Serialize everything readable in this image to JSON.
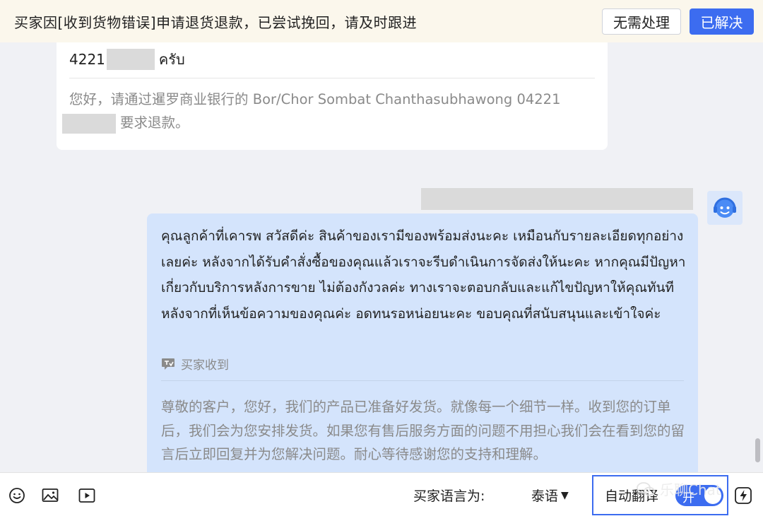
{
  "banner": {
    "message": "买家因[收到货物错误]申请退货退款，已尝试挽回，请及时跟进",
    "no_action_label": "无需处理",
    "resolved_label": "已解决"
  },
  "messages": {
    "incoming": {
      "text_prefix": "4221",
      "text_suffix": "ครับ",
      "translation_prefix": "您好，请通过暹罗商业银行的 Bor/Chor Sombat Chanthasubhawong 04221",
      "translation_suffix": "要求退款。"
    },
    "outgoing": {
      "text": "คุณลูกค้าที่เคารพ สวัสดีค่ะ สินค้าของเรามีของพร้อมส่งนะคะ เหมือนกับรายละเอียดทุกอย่างเลยค่ะ หลังจากได้รับคำสั่งซื้อของคุณแล้วเราจะรีบดำเนินการจัดส่งให้นะคะ หากคุณมีปัญหาเกี่ยวกับบริการหลังการขาย ไม่ต้องกังวลค่ะ ทางเราจะตอบกลับและแก้ไขปัญหาให้คุณทันทีหลังจากที่เห็นข้อความของคุณค่ะ อดทนรอหน่อยนะคะ ขอบคุณที่สนับสนุนและเข้าใจค่ะ",
      "receipt_label": "买家收到",
      "translation": "尊敬的客户，您好，我们的产品已准备好发货。就像每一个细节一样。收到您的订单后，我们会为您安排发货。如果您有售后服务方面的问题不用担心我们会在看到您的留言后立即回复并为您解决问题。耐心等待感谢您的支持和理解。"
    }
  },
  "toolbar": {
    "buyer_language_label": "买家语言为:",
    "buyer_language_value": "泰语",
    "auto_translate_label": "自动翻译",
    "toggle_label": "开",
    "toggle_on": true,
    "watermark": "乐聊Chat",
    "icons": [
      "emoji-icon",
      "image-icon",
      "video-icon",
      "flash-icon"
    ]
  },
  "colors": {
    "accent": "#3c6cf0",
    "banner_bg": "#fbf7ec",
    "outgoing_bubble": "#d4e4fc",
    "chat_bg": "#f0f1f5"
  }
}
